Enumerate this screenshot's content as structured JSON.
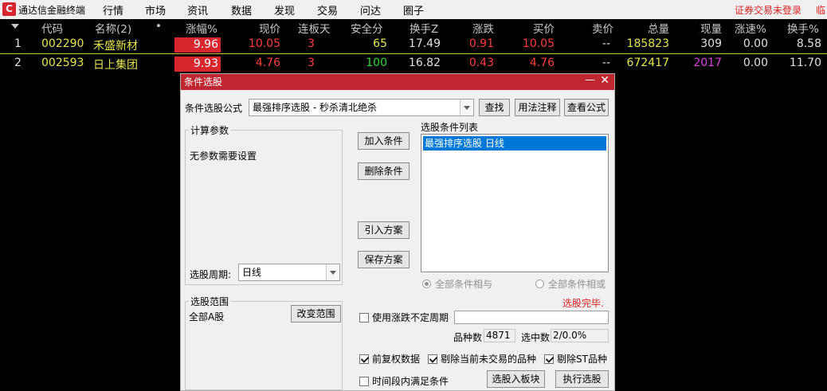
{
  "app": {
    "name": "通达信金融终端",
    "logo": "C",
    "status": "证券交易未登录",
    "status_more": "临"
  },
  "menu": [
    "行情",
    "市场",
    "资讯",
    "数据",
    "发现",
    "交易",
    "问达",
    "圈子"
  ],
  "table": {
    "headers": [
      "代码",
      "名称(2)",
      "•",
      "涨幅%",
      "现价",
      "连板天",
      "安全分",
      "换手Z",
      "涨跌",
      "买价",
      "卖价",
      "总量",
      "现量",
      "涨速%",
      "换手%"
    ],
    "rows": [
      {
        "idx": "1",
        "code": "002290",
        "name": "禾盛新材",
        "pct": "9.96",
        "price": "10.05",
        "days": "3",
        "safe": "65",
        "turnz": "17.49",
        "chg": "0.91",
        "bid": "10.05",
        "ask": "--",
        "vol": "185823",
        "now": "309",
        "speed": "0.00",
        "turn": "8.58"
      },
      {
        "idx": "2",
        "code": "002593",
        "name": "日上集团",
        "pct": "9.93",
        "price": "4.76",
        "days": "3",
        "safe": "100",
        "turnz": "16.82",
        "chg": "0.43",
        "bid": "4.76",
        "ask": "--",
        "vol": "672417",
        "now": "2017",
        "speed": "0.00",
        "turn": "11.70"
      }
    ]
  },
  "dialog": {
    "title": "条件选股",
    "formula_label": "条件选股公式",
    "formula_value": "最强排序选股 - 秒杀清北绝杀",
    "btn_find": "查找",
    "btn_usage": "用法注释",
    "btn_view": "查看公式",
    "params_title": "计算参数",
    "params_text": "无参数需要设置",
    "period_label": "选股周期:",
    "period_value": "日线",
    "btn_add": "加入条件",
    "btn_delete": "删除条件",
    "btn_import": "引入方案",
    "btn_save": "保存方案",
    "list_title": "选股条件列表",
    "list_item": "最强排序选股  日线",
    "radio_and": "全部条件相与",
    "radio_or": "全部条件相或",
    "done": "选股完毕.",
    "range_title": "选股范围",
    "range_value": "全部A股",
    "btn_range": "改变范围",
    "chk_uncertain": "使用涨跌不定周期",
    "count_label": "品种数",
    "count_value": "4871",
    "select_label": "选中数",
    "select_value": "2/0.0%",
    "chk_adjust": "前复权数据",
    "chk_exclude_halt": "剔除当前未交易的品种",
    "chk_exclude_st": "剔除ST品种",
    "chk_timerange": "时间段内满足条件",
    "btn_toblock": "选股入板块",
    "btn_run": "执行选股"
  }
}
